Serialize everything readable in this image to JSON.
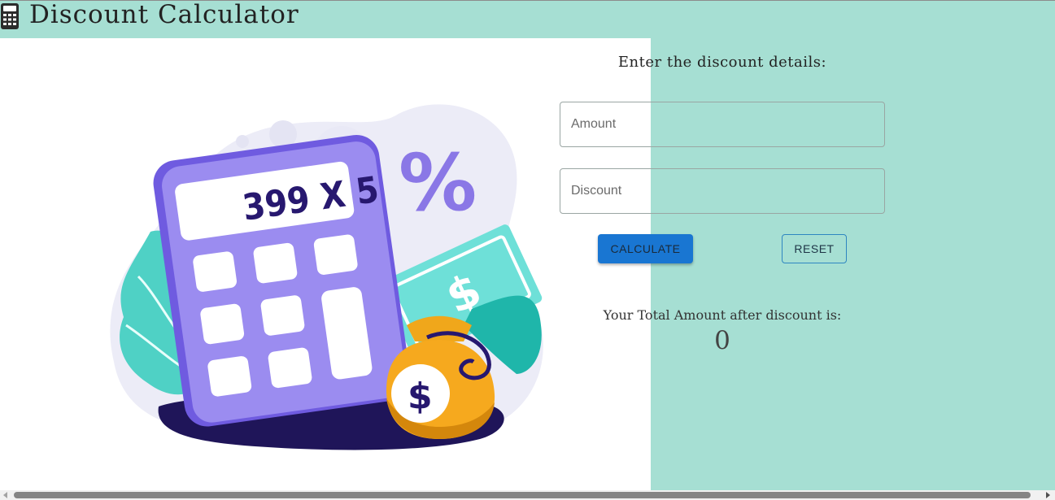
{
  "header": {
    "title": "Discount Calculator",
    "icon": "calculator-icon"
  },
  "illustration": {
    "calculator_display": "399 X 5",
    "percent_symbol": "%",
    "dollar_symbol": "$"
  },
  "form": {
    "heading": "Enter the discount details:",
    "amount_placeholder": "Amount",
    "amount_value": "",
    "discount_placeholder": "Discount",
    "discount_value": "",
    "calculate_label": "CALCULATE",
    "reset_label": "RESET"
  },
  "result": {
    "label": "Your Total Amount after discount is:",
    "value": "0"
  },
  "colors": {
    "background": "#a6dfd3",
    "primary_button": "#1976d2",
    "panel": "#ffffff"
  }
}
